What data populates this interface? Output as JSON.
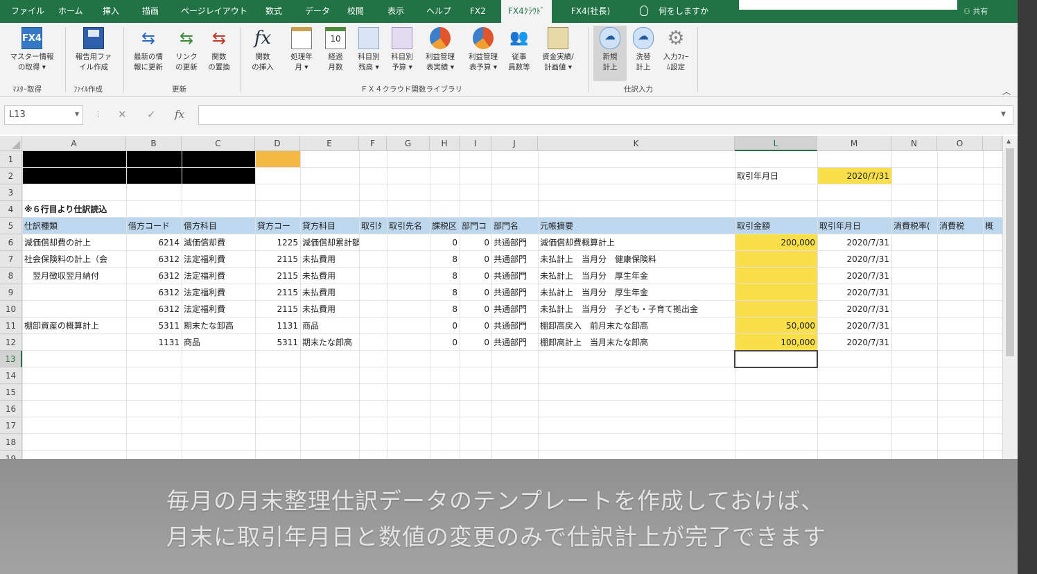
{
  "ribbon_tabs": [
    "ファイル",
    "ホーム",
    "挿入",
    "描画",
    "ページレイアウト",
    "数式",
    "データ",
    "校閲",
    "表示",
    "ヘルプ",
    "FX2",
    "FX4ｸﾗｳﾄﾞ",
    "FX4(社長)"
  ],
  "active_tab": "FX4ｸﾗｳﾄﾞ",
  "tell_me": "何をしますか",
  "share_label": "共有",
  "ribbon": {
    "buttons": [
      {
        "label": "マスター情報\nの取得 ▾",
        "icon": "fx4-logo-icon"
      },
      {
        "label": "報告用ファ\nイル作成",
        "icon": "save-file-icon"
      },
      {
        "label": "最新の情\n報に更新",
        "icon": "refresh-arrows-icon"
      },
      {
        "label": "リンク\nの更新",
        "icon": "link-refresh-icon"
      },
      {
        "label": "関数\nの置換",
        "icon": "replace-function-icon"
      },
      {
        "label": "関数\nの挿入",
        "icon": "insert-function-icon"
      },
      {
        "label": "処理年\n月 ▾",
        "icon": "calendar-icon"
      },
      {
        "label": "経過\n月数",
        "icon": "calendar-10-icon"
      },
      {
        "label": "科目別\n残高 ▾",
        "icon": "balance-doc-icon"
      },
      {
        "label": "科目別\n予算 ▾",
        "icon": "budget-doc-icon"
      },
      {
        "label": "利益管理\n表実績 ▾",
        "icon": "profit-actual-chart-icon"
      },
      {
        "label": "利益管理\n表予算 ▾",
        "icon": "profit-budget-chart-icon"
      },
      {
        "label": "従事\n員数等",
        "icon": "employees-icon"
      },
      {
        "label": "資金実績/\n計画値 ▾",
        "icon": "funds-icon"
      },
      {
        "label": "新規\n計上",
        "icon": "new-entry-cloud-icon"
      },
      {
        "label": "洗替\n計上",
        "icon": "reversal-entry-icon"
      },
      {
        "label": "入力ﾌｫｰ\nﾑ設定",
        "icon": "form-settings-icon"
      }
    ],
    "groups": [
      "ﾏｽﾀｰ取得",
      "ﾌｧｲﾙ作成",
      "更新",
      "ＦＸ４クラウド関数ライブラリ",
      "仕訳入力"
    ]
  },
  "formula_bar": {
    "name_box": "L13",
    "fx_label": "fx",
    "formula": ""
  },
  "columns": [
    "A",
    "B",
    "C",
    "D",
    "E",
    "F",
    "G",
    "H",
    "I",
    "J",
    "K",
    "L",
    "M",
    "N",
    "O"
  ],
  "selected_column": "L",
  "rows": [
    "1",
    "2",
    "3",
    "4",
    "5",
    "6",
    "7",
    "8",
    "9",
    "10",
    "11",
    "12",
    "13",
    "14",
    "15",
    "16",
    "17",
    "18",
    "19"
  ],
  "selected_row": "13",
  "sheet": {
    "r2": {
      "L": "取引年月日",
      "M": "2020/7/31"
    },
    "r4": {
      "A": "※６行目より仕訳読込"
    },
    "r5": {
      "A": "仕訳種類",
      "B": "借方コード",
      "C": "借方科目",
      "D": "貸方コー",
      "E": "貸方科目",
      "F": "取引ﾀ",
      "G": "取引先名",
      "H": "課税区",
      "I": "部門コ",
      "J": "部門名",
      "K": "元帳摘要",
      "L": "取引金額",
      "M": "取引年月日",
      "N": "消費税率(",
      "O": "消費税",
      "P": "概"
    },
    "data_rows": [
      {
        "A": "減価償却費の計上",
        "B": "6214",
        "C": "減価償却費",
        "D": "1225",
        "E": "減価償却累計額",
        "H": "0",
        "I": "0",
        "J": "共通部門",
        "K": "減価償却費概算計上",
        "L": "200,000",
        "M": "2020/7/31"
      },
      {
        "A": "社会保険料の計上（会",
        "B": "6312",
        "C": "法定福利費",
        "D": "2115",
        "E": "未払費用",
        "H": "8",
        "I": "0",
        "J": "共通部門",
        "K": "未払計上　当月分　健康保険料",
        "L": "",
        "M": "2020/7/31"
      },
      {
        "A": "　翌月徴収翌月納付",
        "B": "6312",
        "C": "法定福利費",
        "D": "2115",
        "E": "未払費用",
        "H": "8",
        "I": "0",
        "J": "共通部門",
        "K": "未払計上　当月分　厚生年金",
        "L": "",
        "M": "2020/7/31"
      },
      {
        "A": "",
        "B": "6312",
        "C": "法定福利費",
        "D": "2115",
        "E": "未払費用",
        "H": "8",
        "I": "0",
        "J": "共通部門",
        "K": "未払計上　当月分　厚生年金",
        "L": "",
        "M": "2020/7/31"
      },
      {
        "A": "",
        "B": "6312",
        "C": "法定福利費",
        "D": "2115",
        "E": "未払費用",
        "H": "8",
        "I": "0",
        "J": "共通部門",
        "K": "未払計上　当月分　子ども・子育て拠出金",
        "L": "",
        "M": "2020/7/31"
      },
      {
        "A": "棚卸資産の概算計上",
        "B": "5311",
        "C": "期末たな卸高",
        "D": "1131",
        "E": "商品",
        "H": "0",
        "I": "0",
        "J": "共通部門",
        "K": "棚卸高戻入　前月末たな卸高",
        "L": "50,000",
        "M": "2020/7/31"
      },
      {
        "A": "",
        "B": "1131",
        "C": "商品",
        "D": "5311",
        "E": "期末たな卸高",
        "H": "0",
        "I": "0",
        "J": "共通部門",
        "K": "棚卸高計上　当月末たな卸高",
        "L": "100,000",
        "M": "2020/7/31"
      }
    ]
  },
  "colors": {
    "excel_green": "#217346",
    "header_blue": "#bdd7ee",
    "highlight_yellow": "#f9e04b",
    "highlight_orange": "#f4b942",
    "redacted": "#000000"
  },
  "subtitle": {
    "line1": "毎月の月末整理仕訳データのテンプレートを作成しておけば、",
    "line2": "月末に取引年月日と数値の変更のみで仕訳計上が完了できます"
  }
}
